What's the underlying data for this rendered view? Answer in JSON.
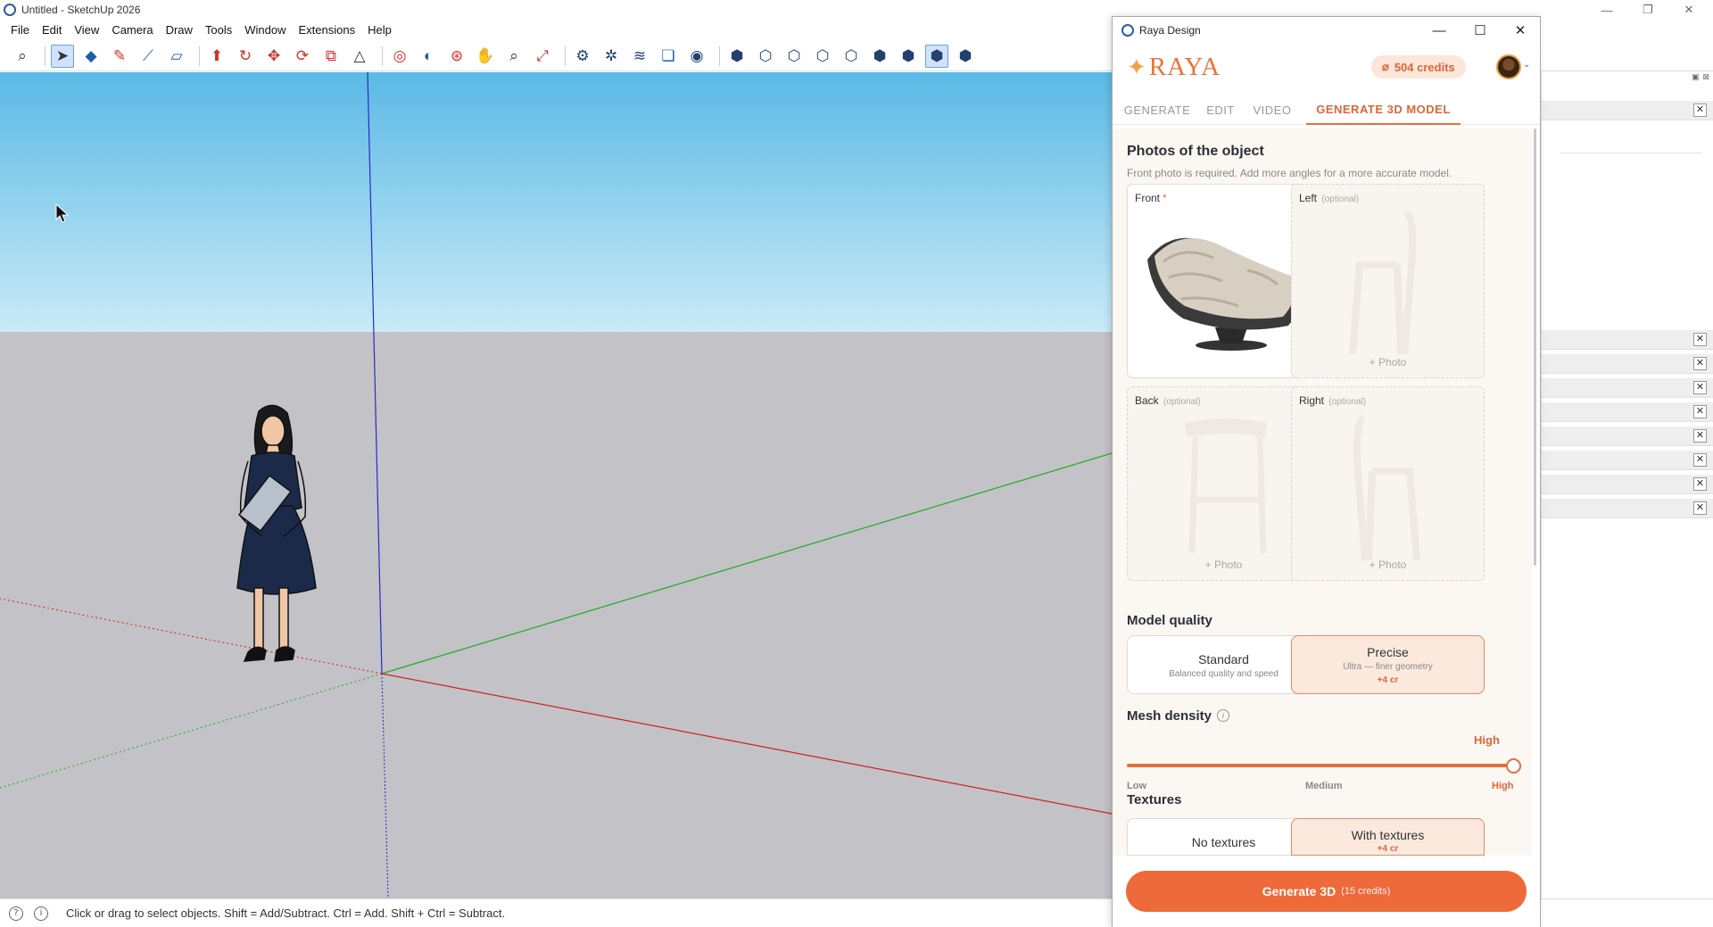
{
  "window": {
    "title": "Untitled - SketchUp 2026",
    "controls": [
      "—",
      "❐",
      "✕"
    ]
  },
  "menu": [
    "File",
    "Edit",
    "View",
    "Camera",
    "Draw",
    "Tools",
    "Window",
    "Extensions",
    "Help"
  ],
  "toolbar": {
    "icons": [
      "search-icon",
      "select-icon",
      "eraser-icon",
      "pencil-icon",
      "line-icon",
      "rectangle-icon",
      "push-pull-icon",
      "follow-me-icon",
      "move-icon",
      "rotate-icon",
      "scale-icon",
      "offset-icon",
      "tape-measure-icon",
      "protractor-icon",
      "orbit-icon",
      "pan-icon",
      "zoom-icon",
      "zoom-extents-icon",
      "components-icon",
      "materials-icon",
      "styles-icon",
      "layers-icon",
      "warehouse-icon",
      "views-iso-icon",
      "views-top-icon",
      "views-front-icon",
      "views-right-icon",
      "views-back-icon",
      "views-left-icon",
      "xray-icon",
      "shaded-icon",
      "monochrome-icon",
      "section-icon",
      "profile-icon",
      "document-icon",
      "user-icon"
    ]
  },
  "status": {
    "text": "Click or drag to select objects. Shift = Add/Subtract. Ctrl = Add. Shift + Ctrl = Subtract."
  },
  "tray": {
    "close_label": "✕"
  },
  "raya": {
    "window_title": "Raya Design",
    "logo": "RAYA",
    "credits": "504 credits",
    "tabs": [
      "GENERATE",
      "EDIT",
      "VIDEO",
      "GENERATE 3D MODEL"
    ],
    "active_tab": "GENERATE 3D MODEL",
    "photos": {
      "title": "Photos of the object",
      "subtitle": "Front photo is required. Add more angles for a more accurate model.",
      "slots": [
        {
          "label": "Front",
          "required_mark": "*",
          "optional": "",
          "filled": true
        },
        {
          "label": "Left",
          "optional": "(optional)",
          "add": "+ Photo"
        },
        {
          "label": "Back",
          "optional": "(optional)",
          "add": "+ Photo"
        },
        {
          "label": "Right",
          "optional": "(optional)",
          "add": "+ Photo"
        }
      ]
    },
    "quality": {
      "title": "Model quality",
      "options": [
        {
          "title": "Standard",
          "subtitle": "Balanced quality and speed",
          "cost": ""
        },
        {
          "title": "Precise",
          "subtitle": "Ultra — finer geometry",
          "cost": "+4 cr"
        }
      ],
      "selected": "Precise"
    },
    "density": {
      "title": "Mesh density",
      "value": "High",
      "level": 1.0,
      "ticks": [
        "Low",
        "Medium",
        "High"
      ]
    },
    "textures": {
      "title": "Textures",
      "options": [
        {
          "title": "No textures",
          "cost": ""
        },
        {
          "title": "With textures",
          "cost": "+4 cr"
        }
      ],
      "selected": "With textures"
    },
    "generate": {
      "label": "Generate 3D",
      "cost": "(15 credits)"
    },
    "colors": {
      "accent": "#e46f3c",
      "accent_light": "#fbe9de",
      "panel_bg": "#fbf7f3"
    }
  }
}
